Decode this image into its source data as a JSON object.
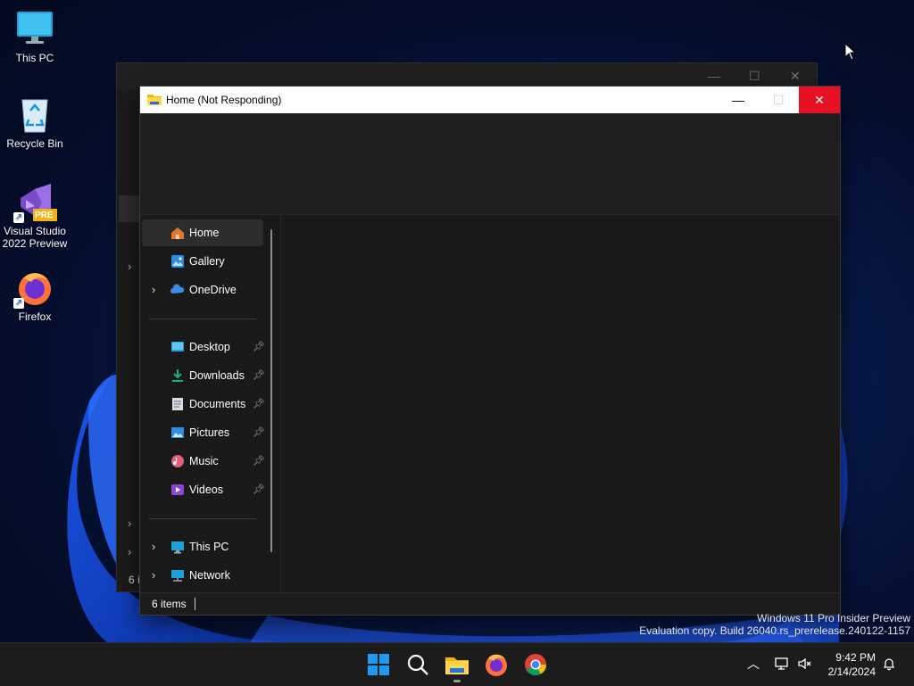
{
  "desktop": {
    "icons": [
      {
        "label": "This PC"
      },
      {
        "label": "Recycle Bin"
      },
      {
        "label": "Visual Studio\n2022 Preview",
        "badge": "PRE"
      },
      {
        "label": "Firefox"
      }
    ]
  },
  "ghost_window": {
    "status_fragment": "6 i"
  },
  "window": {
    "title": "Home (Not Responding)",
    "nav": {
      "quick": [
        {
          "label": "Home",
          "selected": true
        },
        {
          "label": "Gallery"
        },
        {
          "label": "OneDrive"
        }
      ],
      "pinned": [
        {
          "label": "Desktop"
        },
        {
          "label": "Downloads"
        },
        {
          "label": "Documents"
        },
        {
          "label": "Pictures"
        },
        {
          "label": "Music"
        },
        {
          "label": "Videos"
        }
      ],
      "devices": [
        {
          "label": "This PC"
        },
        {
          "label": "Network"
        }
      ]
    },
    "status": "6 items"
  },
  "watermark": {
    "line1": "Windows 11 Pro Insider Preview",
    "line2": "Evaluation copy. Build 26040.rs_prerelease.240122-1157"
  },
  "taskbar": {
    "time": "9:42 PM",
    "date": "2/14/2024"
  },
  "colors": {
    "close_red": "#e81123",
    "accent_blue": "#1a73e8"
  }
}
